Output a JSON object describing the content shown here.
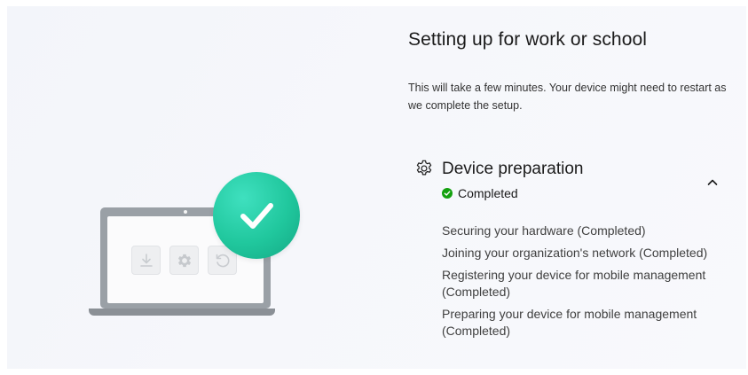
{
  "setup": {
    "title": "Setting up for work or school",
    "description": "This will take a few minutes. Your device might need to restart as we complete the setup."
  },
  "section": {
    "title": "Device preparation",
    "status": "Completed",
    "icon": "gear-icon",
    "steps": [
      "Securing your hardware (Completed)",
      "Joining your organization's network (Completed)",
      "Registering your device for mobile management (Completed)",
      "Preparing your device for mobile management (Completed)"
    ]
  },
  "illustration": {
    "tiles": [
      "download-icon",
      "gear-icon",
      "refresh-icon"
    ],
    "badge": "checkmark-icon"
  },
  "colors": {
    "success_green": "#13a10e",
    "check_teal": "#20c79d",
    "laptop_gray": "#9aa0a6"
  }
}
